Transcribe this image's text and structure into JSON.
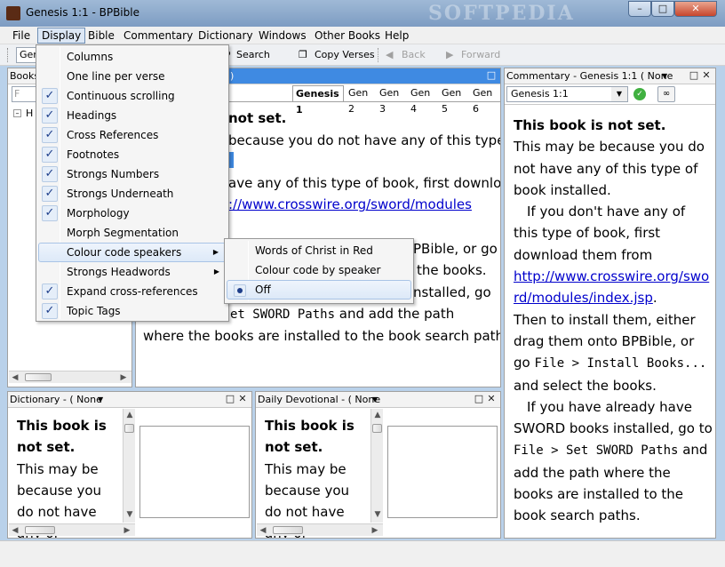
{
  "window": {
    "title": "Genesis 1:1 - BPBible",
    "watermark": "SOFTPEDIA",
    "minimize": "–",
    "maximize": "□",
    "close": "✕"
  },
  "menubar": [
    "File",
    "Display",
    "Bible",
    "Commentary",
    "Dictionary",
    "Windows",
    "Other Books",
    "Help"
  ],
  "toolbar": {
    "reference_value": "Gen",
    "search": "Search",
    "copy_verses": "Copy Verses",
    "back": "Back",
    "forward": "Forward"
  },
  "display_menu": [
    {
      "label": "Columns",
      "checked": false,
      "submenu": false
    },
    {
      "label": "One line per verse",
      "checked": false,
      "submenu": false
    },
    {
      "label": "Continuous scrolling",
      "checked": true,
      "submenu": false
    },
    {
      "label": "Headings",
      "checked": true,
      "submenu": false
    },
    {
      "label": "Cross References",
      "checked": true,
      "submenu": false
    },
    {
      "label": "Footnotes",
      "checked": true,
      "submenu": false
    },
    {
      "label": "Strongs Numbers",
      "checked": true,
      "submenu": false
    },
    {
      "label": "Strongs Underneath",
      "checked": true,
      "submenu": false
    },
    {
      "label": "Morphology",
      "checked": true,
      "submenu": false
    },
    {
      "label": "Morph Segmentation",
      "checked": false,
      "submenu": false
    },
    {
      "label": "Colour code speakers",
      "checked": false,
      "submenu": true
    },
    {
      "label": "Strongs Headwords",
      "checked": false,
      "submenu": true
    },
    {
      "label": "Expand cross-references",
      "checked": true,
      "submenu": false
    },
    {
      "label": "Topic Tags",
      "checked": true,
      "submenu": false
    }
  ],
  "colour_submenu": [
    "Words of Christ in Red",
    "Colour code by speaker",
    "Off"
  ],
  "books_panel": {
    "title": "Books",
    "filter_placeholder": "F",
    "tree_item": "H"
  },
  "bible_panel": {
    "tabs": [
      "Genesis 1",
      "Gen 2",
      "Gen 3",
      "Gen 4",
      "Gen 5",
      "Gen 6"
    ],
    "title_fragment": ")",
    "lines": {
      "l1": "not set.",
      "l2": "because you do not have any of this type of",
      "l4a": "ave any of this type of book, first download",
      "l5": "://www.crosswire.org/sword/modules",
      "l6": "PBible, or go",
      "l7": "the books.",
      "l8": "nstalled, go",
      "l9_mono": "et SWORD Paths",
      "l9b": " and add the path",
      "l10": "where the books are installed to the book search paths."
    }
  },
  "commentary_panel": {
    "title": "Commentary - Genesis 1:1 ( None",
    "reference_value": "Genesis 1:1",
    "text": {
      "t1": "This book is not set.",
      "t2": "This may be because you do not have any of this type of book installed.",
      "t3": "If you don't have any of this type of book, first download them from",
      "t4": "http://www.crosswire.org/sword/modules/index.jsp",
      "t4b": ".",
      "t5": "Then to install them, either drag them onto BPBible, or go",
      "t5m": "File > Install Books...",
      "t5c": "and select the books.",
      "t6": "If you have already have SWORD books installed, go to",
      "t6m": "File > Set SWORD Paths",
      "t6c": "and add the path where the books are installed to the book search paths."
    }
  },
  "dictionary_panel": {
    "title": "Dictionary - ( None",
    "bold": "This book is not set.",
    "text": "This may be because you do not have any of"
  },
  "devotional_panel": {
    "title": "Daily Devotional - ( None",
    "bold": "This book is not set.",
    "text": "This may be because you do not have any of"
  }
}
